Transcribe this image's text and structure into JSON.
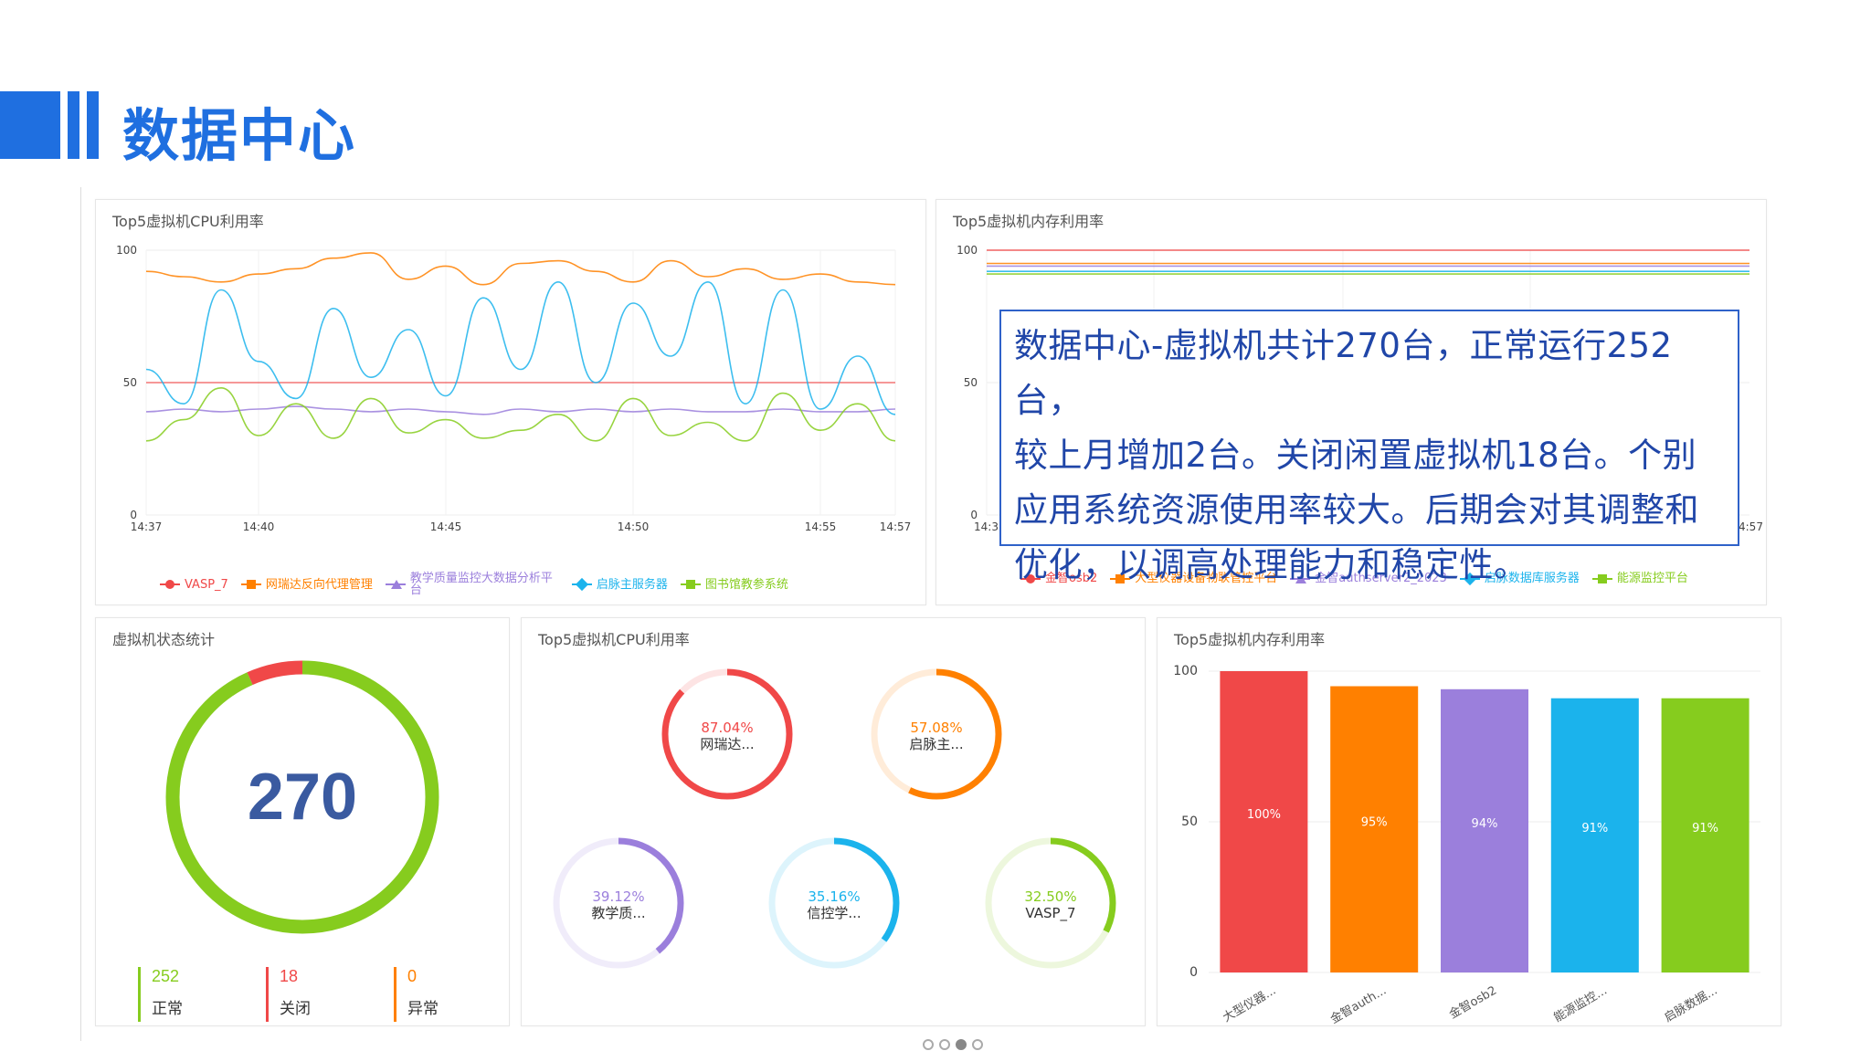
{
  "header": {
    "title": "数据中心"
  },
  "colors": {
    "accent": "#1f6fe0",
    "red": "#f04848",
    "orange": "#ff8000",
    "purple": "#9b7fdc",
    "cyan": "#1bb3ec",
    "green": "#86cc1e"
  },
  "panel_cpu_line": {
    "title": "Top5虚拟机CPU利用率",
    "y_ticks": [
      "0",
      "50",
      "100"
    ],
    "x_ticks": [
      "14:37",
      "14:40",
      "14:45",
      "14:50",
      "14:55",
      "14:57"
    ],
    "legend": [
      "VASP_7",
      "网瑞达反向代理管理",
      "教学质量监控大数据分析平台",
      "启脉主服务器",
      "图书馆教参系统"
    ]
  },
  "panel_mem_line": {
    "title": "Top5虚拟机内存利用率",
    "y_ticks": [
      "0",
      "50",
      "100"
    ],
    "x_ticks": [
      "14:3",
      "4:57"
    ],
    "legend": [
      "金智osb2",
      "大型仪器设备物联管控平台",
      "金智authserver2_2023",
      "启脉数据库服务器",
      "能源监控平台"
    ]
  },
  "summary": {
    "lines": [
      "数据中心-虚拟机共计270台，正常运行252台，",
      "较上月增加2台。关闭闲置虚拟机18台。个别",
      "应用系统资源使用率较大。后期会对其调整和",
      "优化，以调高处理能力和稳定性。"
    ]
  },
  "panel_status": {
    "title": "虚拟机状态统计",
    "total": "270",
    "stats": [
      {
        "value": "252",
        "label": "正常",
        "color": "#86cc1e"
      },
      {
        "value": "18",
        "label": "关闭",
        "color": "#f04848"
      },
      {
        "value": "0",
        "label": "异常",
        "color": "#ff8000"
      }
    ]
  },
  "panel_cpu_rings": {
    "title": "Top5虚拟机CPU利用率",
    "rings": [
      {
        "pct": "87.04%",
        "name": "网瑞达...",
        "fraction": 0.8704,
        "color": "#f04848"
      },
      {
        "pct": "57.08%",
        "name": "启脉主...",
        "fraction": 0.5708,
        "color": "#ff8000"
      },
      {
        "pct": "39.12%",
        "name": "教学质...",
        "fraction": 0.3912,
        "color": "#9b7fdc"
      },
      {
        "pct": "35.16%",
        "name": "信控学...",
        "fraction": 0.3516,
        "color": "#1bb3ec"
      },
      {
        "pct": "32.50%",
        "name": "VASP_7",
        "fraction": 0.325,
        "color": "#86cc1e"
      }
    ]
  },
  "panel_mem_bars": {
    "title": "Top5虚拟机内存利用率",
    "y_ticks": [
      "0",
      "50",
      "100"
    ]
  },
  "chart_data": [
    {
      "type": "line",
      "title": "Top5虚拟机CPU利用率",
      "xlabel": "",
      "ylabel": "",
      "ylim": [
        0,
        100
      ],
      "x_ticks": [
        "14:37",
        "14:40",
        "14:45",
        "14:50",
        "14:55",
        "14:57"
      ],
      "series": [
        {
          "name": "VASP_7",
          "values": [
            50,
            50,
            50,
            50,
            50,
            50,
            50,
            50,
            50,
            50,
            50,
            50,
            50,
            50,
            50,
            50,
            50,
            50,
            50,
            50,
            50
          ]
        },
        {
          "name": "网瑞达反向代理管理",
          "values": [
            92,
            90,
            88,
            91,
            93,
            97,
            99,
            89,
            94,
            87,
            95,
            96,
            92,
            88,
            96,
            90,
            93,
            89,
            91,
            88,
            87
          ]
        },
        {
          "name": "教学质量监控大数据分析平台",
          "values": [
            39,
            40,
            39,
            40,
            41,
            40,
            39,
            40,
            39,
            38,
            40,
            39,
            40,
            39,
            40,
            39,
            39,
            40,
            39,
            39,
            40
          ]
        },
        {
          "name": "启脉主服务器",
          "values": [
            55,
            42,
            85,
            58,
            44,
            78,
            52,
            70,
            45,
            82,
            55,
            88,
            50,
            80,
            60,
            88,
            42,
            85,
            40,
            60,
            38
          ]
        },
        {
          "name": "图书馆教参系统",
          "values": [
            28,
            36,
            48,
            30,
            42,
            29,
            44,
            31,
            36,
            29,
            32,
            38,
            28,
            44,
            30,
            35,
            28,
            46,
            32,
            42,
            28
          ]
        }
      ]
    },
    {
      "type": "line",
      "title": "Top5虚拟机内存利用率",
      "xlabel": "",
      "ylabel": "",
      "ylim": [
        0,
        100
      ],
      "series": [
        {
          "name": "金智osb2",
          "values": [
            100,
            100
          ]
        },
        {
          "name": "大型仪器设备物联管控平台",
          "values": [
            95,
            95
          ]
        },
        {
          "name": "金智authserver2_2023",
          "values": [
            94,
            94
          ]
        },
        {
          "name": "启脉数据库服务器",
          "values": [
            92,
            92
          ]
        },
        {
          "name": "能源监控平台",
          "values": [
            91,
            91
          ]
        }
      ]
    },
    {
      "type": "pie",
      "title": "虚拟机状态统计",
      "categories": [
        "正常",
        "关闭",
        "异常"
      ],
      "values": [
        252,
        18,
        0
      ]
    },
    {
      "type": "bar",
      "title": "Top5虚拟机内存利用率",
      "categories": [
        "大型仪器...",
        "金智auth...",
        "金智osb2",
        "能源监控...",
        "启脉数据..."
      ],
      "values": [
        100,
        95,
        94,
        91,
        91
      ],
      "labels": [
        "100%",
        "95%",
        "94%",
        "91%",
        "91%"
      ],
      "ylim": [
        0,
        100
      ]
    }
  ]
}
